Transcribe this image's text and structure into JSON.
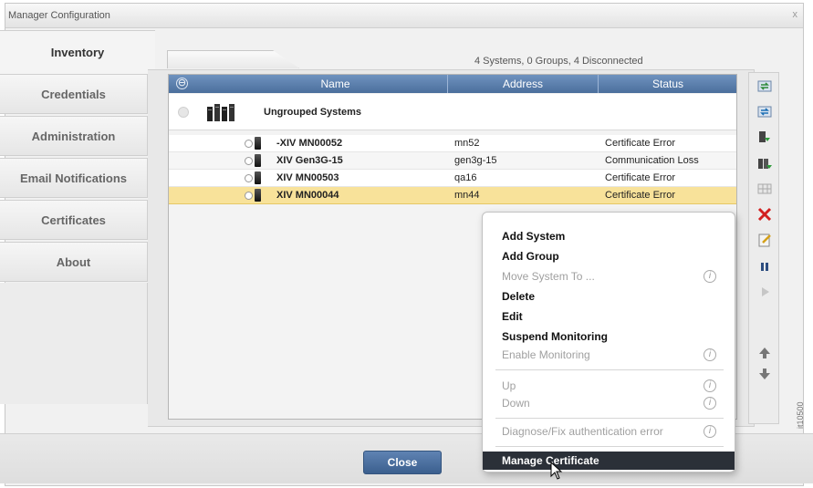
{
  "window": {
    "title": "Manager Configuration",
    "close_glyph": "x"
  },
  "nav": {
    "items": [
      {
        "label": "Inventory",
        "active": true
      },
      {
        "label": "Credentials"
      },
      {
        "label": "Administration"
      },
      {
        "label": "Email Notifications"
      },
      {
        "label": "Certificates"
      },
      {
        "label": "About"
      }
    ]
  },
  "summary": "4 Systems, 0 Groups, 4 Disconnected",
  "table": {
    "collapse_glyph": "⊖",
    "columns": [
      "Name",
      "Address",
      "Status"
    ],
    "group": {
      "label": "Ungrouped Systems"
    },
    "rows": [
      {
        "name": "-XIV MN00052",
        "address": "mn52",
        "status": "Certificate Error"
      },
      {
        "name": "XIV Gen3G-15",
        "address": "gen3g-15",
        "status": "Communication Loss"
      },
      {
        "name": "XIV MN00503",
        "address": "qa16",
        "status": "Certificate Error"
      },
      {
        "name": "XIV MN00044",
        "address": "mn44",
        "status": "Certificate Error",
        "selected": true
      }
    ]
  },
  "context_menu": {
    "items": [
      {
        "label": "Add System",
        "enabled": true
      },
      {
        "label": "Add Group",
        "enabled": true
      },
      {
        "label": "Move System To ...",
        "enabled": false,
        "info": "i"
      },
      {
        "label": "Delete",
        "enabled": true
      },
      {
        "label": "Edit",
        "enabled": true
      },
      {
        "label": "Suspend Monitoring",
        "enabled": true
      },
      {
        "label": "Enable Monitoring",
        "enabled": false,
        "info": "i"
      },
      {
        "label": "Up",
        "enabled": false,
        "info": "i"
      },
      {
        "label": "Down",
        "enabled": false,
        "info": "i"
      },
      {
        "label": "Diagnose/Fix authentication error",
        "enabled": false,
        "info": "i"
      },
      {
        "label": "Manage Certificate",
        "enabled": true,
        "highlighted": true
      }
    ]
  },
  "footer": {
    "close_label": "Close"
  },
  "figure_tag": "it10500",
  "colors": {
    "header_blue": "#5a7fae",
    "selected_row": "#f8e29a",
    "menu_highlight": "#2b3038",
    "delete_red": "#d21f1f"
  },
  "toolbar_icons": [
    "refresh-icon",
    "sync-icon",
    "add-system-icon",
    "add-group-icon",
    "grid-icon",
    "delete-icon",
    "edit-icon",
    "pause-icon",
    "play-icon",
    "up-arrow-icon",
    "down-arrow-icon"
  ]
}
